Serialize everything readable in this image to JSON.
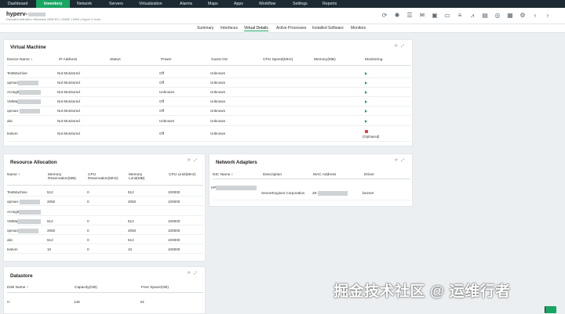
{
  "topnav": {
    "items": [
      "Dashboard",
      "Inventory",
      "Network",
      "Servers",
      "Virtualization",
      "Alarms",
      "Maps",
      "Apps",
      "Workflow",
      "Settings",
      "Reports"
    ],
    "active": "Inventory"
  },
  "header": {
    "title": "hyperv-",
    "subtitle": "DomainController | Windows 2008 R2 | SNMP | WMI | Hyper-V host"
  },
  "tabs": [
    "Summary",
    "Interfaces",
    "Virtual Details",
    "Active Processes",
    "Installed Software",
    "Monitors"
  ],
  "active_tab": "Virtual Details",
  "vm": {
    "title": "Virtual Machine",
    "headers": [
      "Device Name",
      "IP Address",
      "Status",
      "Power",
      "Guest OS",
      "CPU Speed(MHz)",
      "Memory(MB)",
      "Monitoring"
    ],
    "rows": [
      {
        "name": "TestMachine",
        "ip": "Not Monitored",
        "power": "Off",
        "os": "Unknown",
        "mon": "play"
      },
      {
        "name": "opman",
        "ip": "Not Monitored",
        "power": "Off",
        "os": "Unknown",
        "mon": "play"
      },
      {
        "name": "Arcsigh",
        "ip": "Not Monitored",
        "power": "Unknown",
        "os": "Unknown",
        "mon": "play"
      },
      {
        "name": "VMMa",
        "ip": "Not Monitored",
        "power": "Off",
        "os": "Unknown",
        "mon": "play"
      },
      {
        "name": "opman-",
        "ip": "Not Monitored",
        "power": "Off",
        "os": "Unknown",
        "mon": "play"
      },
      {
        "name": "abc",
        "ip": "Not Monitored",
        "power": "Unknown",
        "os": "Unknown",
        "mon": "play"
      },
      {
        "name": "testvm",
        "ip": "Not Monitored",
        "power": "Off",
        "os": "Unknown",
        "mon": "orphaned",
        "mon_label": "(Orphaned)"
      }
    ]
  },
  "ra": {
    "title": "Resource Allocation",
    "headers": [
      "Name",
      "Memory Reservation(MB)",
      "CPU Reservation(MHz)",
      "Memory Limit(MB)",
      "CPU Limit(MHz)"
    ],
    "rows": [
      [
        "TestMachine",
        "512",
        "0",
        "512",
        "100000"
      ],
      [
        "opman-",
        "2050",
        "0",
        "2050",
        "100000"
      ],
      [
        "Arcsigh",
        "",
        "",
        "",
        ""
      ],
      [
        "VMMa",
        "512",
        "0",
        "512",
        "100000"
      ],
      [
        "opman",
        "2050",
        "0",
        "2050",
        "100000"
      ],
      [
        "abc",
        "512",
        "0",
        "512",
        "100000"
      ],
      [
        "testvm",
        "10",
        "0",
        "10",
        "100000"
      ]
    ]
  },
  "na": {
    "title": "Network Adapters",
    "headers": [
      "NIC Name",
      "Description",
      "MAC Address",
      "Driver"
    ],
    "rows": [
      {
        "nic": "HP",
        "desc": "ServerEngines Corporation",
        "mac": "29-",
        "driver": "be2net"
      }
    ]
  },
  "ds": {
    "title": "Datastore",
    "headers": [
      "Disk Name",
      "Capacity(GB)",
      "Free Space(GB)"
    ],
    "rows": [
      [
        "C:",
        "148",
        "61"
      ]
    ]
  },
  "watermark": "掘金技术社区 @ 运维行者",
  "colors": {
    "accent": "#19a562",
    "nav_bg": "#1d2a33",
    "orphaned": "#e53935"
  }
}
